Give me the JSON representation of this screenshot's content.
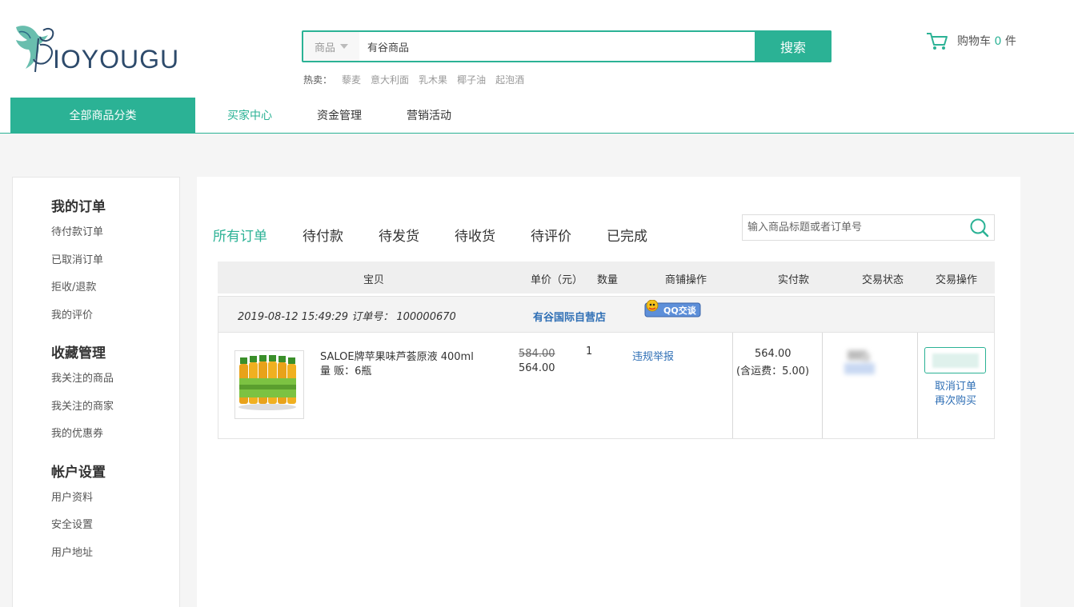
{
  "header": {
    "logo_text": "IOYOUGU",
    "search": {
      "category": "商品",
      "value": "有谷商品",
      "button": "搜索"
    },
    "hot": {
      "label": "热卖：",
      "items": [
        "藜麦",
        "意大利面",
        "乳木果",
        "椰子油",
        "起泡酒"
      ]
    },
    "cart": {
      "label": "购物车",
      "count": "0",
      "unit": "件"
    }
  },
  "nav": {
    "all": "全部商品分类",
    "items": [
      "买家中心",
      "资金管理",
      "营销活动"
    ],
    "active": "买家中心"
  },
  "sidebar": {
    "groups": [
      {
        "title": "我的订单",
        "links": [
          "待付款订单",
          "已取消订单",
          "拒收/退款",
          "我的评价"
        ]
      },
      {
        "title": "收藏管理",
        "links": [
          "我关注的商品",
          "我关注的商家",
          "我的优惠券"
        ]
      },
      {
        "title": "帐户设置",
        "links": [
          "用户资料",
          "安全设置",
          "用户地址"
        ]
      }
    ]
  },
  "tabs": [
    "所有订单",
    "待付款",
    "待发货",
    "待收货",
    "待评价",
    "已完成"
  ],
  "order_search": {
    "placeholder": "输入商品标题或者订单号"
  },
  "table": {
    "headers": [
      "宝贝",
      "单价（元）",
      "数量",
      "商铺操作",
      "实付款",
      "交易状态",
      "交易操作"
    ]
  },
  "order": {
    "date_no": "2019-08-12 15:49:29 订单号： 100000670",
    "shop": "有谷国际自营店",
    "qq_label": "QQ交谈",
    "product_name": "SALOE牌苹果味芦荟原液 400ml",
    "product_spec": "量 贩：6瓶",
    "price_old": "584.00",
    "price_new": "564.00",
    "quantity": "1",
    "shop_action": "违规举报",
    "paid": "564.00",
    "paid_shipping": "(含运费：5.00)",
    "actions": [
      "取消订单",
      "再次购买"
    ]
  },
  "colors": {
    "accent": "#2bb295",
    "link": "#2f6fb5"
  }
}
